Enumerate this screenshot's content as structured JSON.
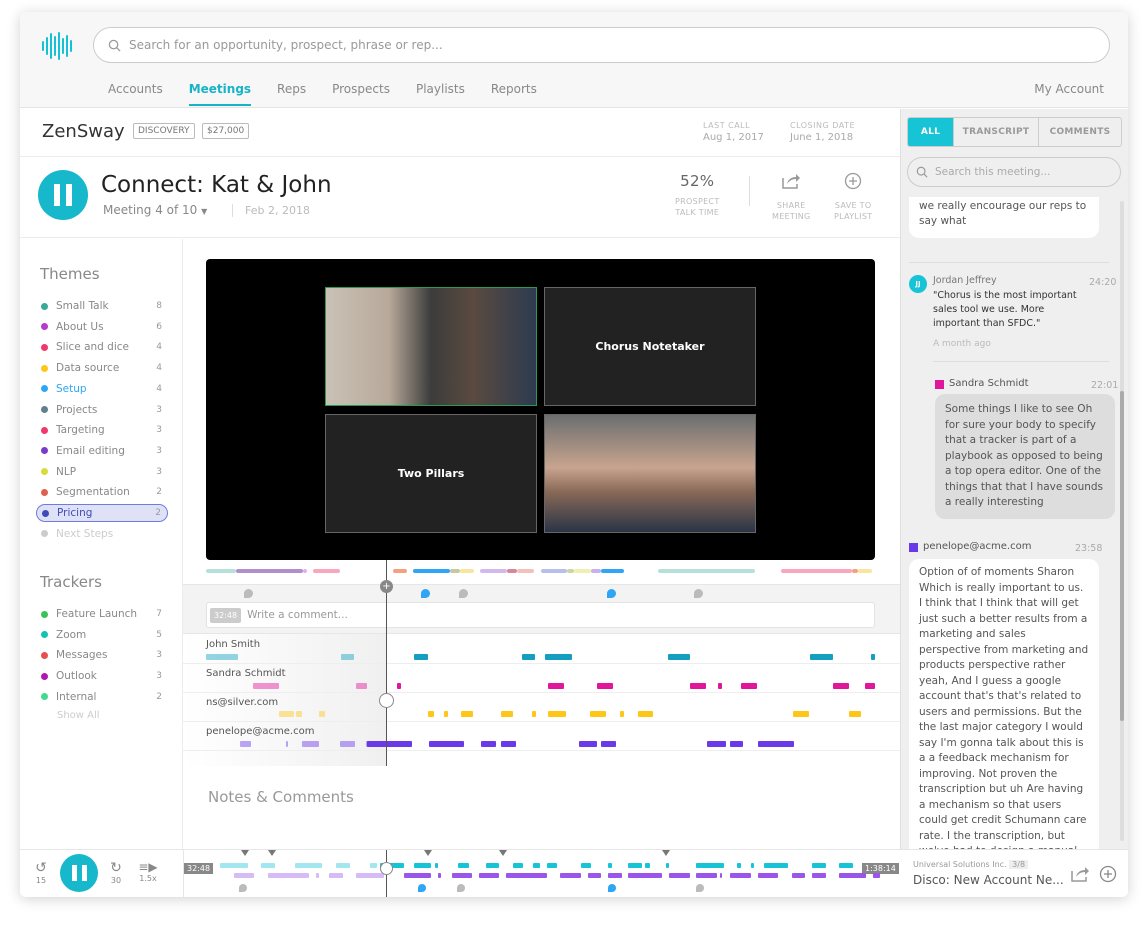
{
  "search": {
    "placeholder": "Search for an opportunity, prospect, phrase or rep..."
  },
  "nav": {
    "items": [
      "Accounts",
      "Meetings",
      "Reps",
      "Prospects",
      "Playlists",
      "Reports"
    ],
    "active": "Meetings",
    "my_account": "My Account"
  },
  "account": {
    "name": "ZenSway",
    "stage": "DISCOVERY",
    "amount": "$27,000",
    "last_call_label": "LAST CALL",
    "last_call": "Aug 1, 2017",
    "closing_label": "CLOSING DATE",
    "closing": "June 1, 2018"
  },
  "meeting": {
    "title": "Connect: Kat & John",
    "index": "Meeting 4 of 10",
    "date": "Feb 2, 2018",
    "talk_time": "52%",
    "talk_label_1": "PROSPECT",
    "talk_label_2": "TALK TIME",
    "share_1": "SHARE",
    "share_2": "MEETING",
    "save_1": "SAVE TO",
    "save_2": "PLAYLIST"
  },
  "themes": {
    "heading": "Themes",
    "items": [
      {
        "label": "Small Talk",
        "count": "8",
        "color": "#3aa898"
      },
      {
        "label": "About Us",
        "count": "6",
        "color": "#b33cc8"
      },
      {
        "label": "Slice and dice",
        "count": "4",
        "color": "#f0386e"
      },
      {
        "label": "Data source",
        "count": "4",
        "color": "#ffc61a"
      },
      {
        "label": "Setup",
        "count": "4",
        "color": "#2ea6f5"
      },
      {
        "label": "Projects",
        "count": "3",
        "color": "#60808e"
      },
      {
        "label": "Targeting",
        "count": "3",
        "color": "#f0386e"
      },
      {
        "label": "Email editing",
        "count": "3",
        "color": "#7a3cc8"
      },
      {
        "label": "NLP",
        "count": "3",
        "color": "#d8dc3a"
      },
      {
        "label": "Segmentation",
        "count": "2",
        "color": "#e0604e"
      },
      {
        "label": "Pricing",
        "count": "2",
        "color": "#3e4bb8"
      },
      {
        "label": "Next Steps",
        "count": "",
        "color": "#cccccc"
      }
    ]
  },
  "trackers": {
    "heading": "Trackers",
    "show_all": "Show All",
    "items": [
      {
        "label": "Feature Launch",
        "count": "7",
        "color": "#3cc05a"
      },
      {
        "label": "Zoom",
        "count": "5",
        "color": "#17c1b0"
      },
      {
        "label": "Messages",
        "count": "3",
        "color": "#e84e4e"
      },
      {
        "label": "Outlook",
        "count": "3",
        "color": "#b019b0"
      },
      {
        "label": "Internal",
        "count": "2",
        "color": "#45d890"
      }
    ]
  },
  "video": {
    "tiles": [
      "Chorus Notetaker",
      "Two Pillars"
    ]
  },
  "playhead": 0.27,
  "theme_timeline": [
    [
      0.0,
      0.045,
      "#b6e0da"
    ],
    [
      0.045,
      0.145,
      "#b08fcc"
    ],
    [
      0.145,
      0.145,
      "#e0b0ec"
    ],
    [
      0.16,
      0.2,
      "#f9a7be"
    ],
    [
      0.28,
      0.3,
      "#f6a080"
    ],
    [
      0.31,
      0.365,
      "#2ea6f5"
    ],
    [
      0.365,
      0.38,
      "#c8c8a0"
    ],
    [
      0.38,
      0.4,
      "#f7e5a0"
    ],
    [
      0.41,
      0.45,
      "#d2b8ec"
    ],
    [
      0.45,
      0.465,
      "#d4889a"
    ],
    [
      0.465,
      0.49,
      "#f5c0b8"
    ],
    [
      0.5,
      0.54,
      "#b8c0ea"
    ],
    [
      0.54,
      0.55,
      "#c8d8a0"
    ],
    [
      0.55,
      0.575,
      "#eef0b0"
    ],
    [
      0.575,
      0.59,
      "#c8b0ec"
    ],
    [
      0.59,
      0.625,
      "#2ea6f5"
    ],
    [
      0.675,
      0.82,
      "#b6e0da"
    ],
    [
      0.86,
      0.965,
      "#f9a7be"
    ],
    [
      0.965,
      0.975,
      "#f6a080"
    ],
    [
      0.975,
      0.995,
      "#f7e5a0"
    ]
  ],
  "comment_markers": [
    [
      0.057,
      "gray"
    ],
    [
      0.321,
      "blue"
    ],
    [
      0.378,
      "gray"
    ],
    [
      0.6,
      "blue"
    ],
    [
      0.73,
      "gray"
    ]
  ],
  "comment_box": {
    "time": "32:48",
    "placeholder": "Write a comment..."
  },
  "speakers": [
    {
      "name": "John Smith",
      "color": "#149fc0",
      "segments": [
        [
          0,
          0.048
        ],
        [
          0.202,
          0.221
        ],
        [
          0.311,
          0.332
        ],
        [
          0.472,
          0.492
        ],
        [
          0.507,
          0.547
        ],
        [
          0.691,
          0.723
        ],
        [
          0.903,
          0.937
        ],
        [
          0.994,
          1
        ]
      ]
    },
    {
      "name": "Sandra Schmidt",
      "color": "#e0179a",
      "segments": [
        [
          0.07,
          0.109
        ],
        [
          0.224,
          0.241
        ],
        [
          0.286,
          0.292
        ],
        [
          0.511,
          0.535
        ],
        [
          0.584,
          0.608
        ],
        [
          0.723,
          0.747
        ],
        [
          0.765,
          0.772
        ],
        [
          0.8,
          0.823
        ],
        [
          0.937,
          0.961
        ],
        [
          0.985,
          1
        ]
      ]
    },
    {
      "name": "ns@silver.com",
      "color": "#ffc61a",
      "segments": [
        [
          0.109,
          0.132
        ],
        [
          0.135,
          0.144
        ],
        [
          0.169,
          0.178
        ],
        [
          0.332,
          0.341
        ],
        [
          0.356,
          0.362
        ],
        [
          0.381,
          0.399
        ],
        [
          0.441,
          0.459
        ],
        [
          0.487,
          0.493
        ],
        [
          0.511,
          0.538
        ],
        [
          0.574,
          0.598
        ],
        [
          0.619,
          0.625
        ],
        [
          0.646,
          0.668
        ],
        [
          0.877,
          0.901
        ],
        [
          0.961,
          0.979
        ]
      ]
    },
    {
      "name": "penelope@acme.com",
      "color": "#6a3ae8",
      "segments": [
        [
          0.051,
          0.067
        ],
        [
          0.12,
          0.121
        ],
        [
          0.144,
          0.169
        ],
        [
          0.201,
          0.223
        ],
        [
          0.239,
          0.24
        ],
        [
          0.24,
          0.3
        ],
        [
          0.292,
          0.308
        ],
        [
          0.334,
          0.386
        ],
        [
          0.411,
          0.433
        ],
        [
          0.441,
          0.463
        ],
        [
          0.557,
          0.584
        ],
        [
          0.59,
          0.613
        ],
        [
          0.749,
          0.778
        ],
        [
          0.784,
          0.802
        ],
        [
          0.825,
          0.879
        ]
      ]
    }
  ],
  "notes": {
    "heading": "Notes & Comments"
  },
  "player": {
    "back": "15",
    "fwd": "30",
    "speed": "1.5x",
    "current": "32:48",
    "total": "1:38:14"
  },
  "mini_top": [
    [
      0.03,
      0.07
    ],
    [
      0.09,
      0.11
    ],
    [
      0.14,
      0.18
    ],
    [
      0.2,
      0.22
    ],
    [
      0.25,
      0.26
    ],
    [
      0.265,
      0.3
    ],
    [
      0.315,
      0.34
    ],
    [
      0.345,
      0.35
    ],
    [
      0.38,
      0.395
    ],
    [
      0.42,
      0.44
    ],
    [
      0.46,
      0.475
    ],
    [
      0.49,
      0.5
    ],
    [
      0.51,
      0.525
    ],
    [
      0.56,
      0.575
    ],
    [
      0.6,
      0.606
    ],
    [
      0.63,
      0.65
    ],
    [
      0.655,
      0.662
    ],
    [
      0.685,
      0.69
    ],
    [
      0.73,
      0.77
    ],
    [
      0.79,
      0.795
    ],
    [
      0.81,
      0.815
    ],
    [
      0.83,
      0.865
    ],
    [
      0.9,
      0.92
    ],
    [
      0.94,
      0.96
    ]
  ],
  "mini_bottom": [
    [
      0.05,
      0.08
    ],
    [
      0.1,
      0.16
    ],
    [
      0.17,
      0.175
    ],
    [
      0.19,
      0.21
    ],
    [
      0.23,
      0.27
    ],
    [
      0.3,
      0.34
    ],
    [
      0.35,
      0.355
    ],
    [
      0.37,
      0.4
    ],
    [
      0.41,
      0.44
    ],
    [
      0.45,
      0.51
    ],
    [
      0.53,
      0.56
    ],
    [
      0.57,
      0.59
    ],
    [
      0.6,
      0.62
    ],
    [
      0.63,
      0.68
    ],
    [
      0.69,
      0.72
    ],
    [
      0.73,
      0.76
    ],
    [
      0.765,
      0.768
    ],
    [
      0.78,
      0.81
    ],
    [
      0.82,
      0.85
    ],
    [
      0.87,
      0.89
    ],
    [
      0.9,
      0.92
    ],
    [
      0.94,
      0.98
    ],
    [
      0.99,
      1
    ]
  ],
  "mini_markers": [
    0.06,
    0.1,
    0.33,
    0.44,
    0.68
  ],
  "right": {
    "tabs": [
      "ALL",
      "TRANSCRIPT",
      "COMMENTS"
    ],
    "search_placeholder": "Search this meeting...",
    "prev_text": "concern for example. We really, we really encourage our reps to say what",
    "comment": {
      "initials": "JJ",
      "author": "Jordan Jeffrey",
      "time": "24:20",
      "text": "\"Chorus is the most important sales tool we use. More important than SFDC.\"",
      "ago": "A month ago"
    },
    "sandra": {
      "name": "Sandra Schmidt",
      "time": "22:01",
      "color": "#e0179a",
      "text": "Some things I like to see Oh for sure your body to specify that a tracker is part of a playbook as opposed to being a top opera editor. One of the things that that I have sounds a really interesting"
    },
    "penelope": {
      "name": "penelope@acme.com",
      "time": "23:58",
      "color": "#6a3ae8",
      "text": "Option of of moments Sharon Which is really important to us. I think that I think that will get just such a better results from a marketing and sales perspective from marketing and products perspective rather yeah, And I guess a google account that's that's related to users and permissions. But the the last major category I would say I'm gonna talk about this is a a feedback mechanism for improving. Not proven the transcription but uh Are having a mechanism so that users could get credit Schumann care rate. I the transcription, but we've had to design a manual process"
    },
    "footer": {
      "company": "Universal Solutions Inc.",
      "position": "3/8",
      "meeting": "Disco: New Account Ne..."
    }
  }
}
